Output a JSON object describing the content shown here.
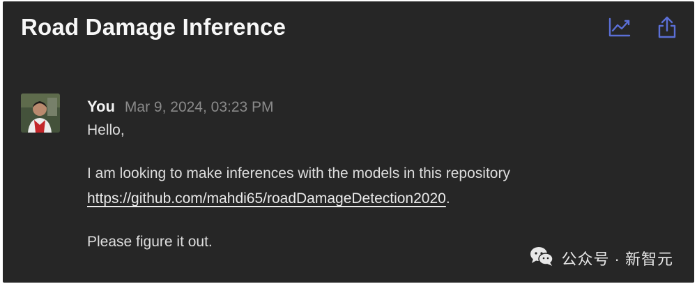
{
  "window": {
    "title": "Road Damage Inference",
    "background": "#262626",
    "accent_icon_color": "#5b6fd6"
  },
  "header": {
    "actions": [
      {
        "icon": "line-chart-icon",
        "label": "analytics"
      },
      {
        "icon": "share-icon",
        "label": "share"
      }
    ]
  },
  "message": {
    "author": "You",
    "timestamp": "Mar 9, 2024, 03:23 PM",
    "avatar": "user-avatar",
    "greeting": "Hello,",
    "line1": "I am looking to make inferences with the models in this repository",
    "link": "https://github.com/mahdi65/roadDamageDetection2020",
    "link_suffix": ".",
    "line3": "Please figure it out."
  },
  "watermark": {
    "icon": "wechat-icon",
    "text": "公众号 · 新智元"
  }
}
